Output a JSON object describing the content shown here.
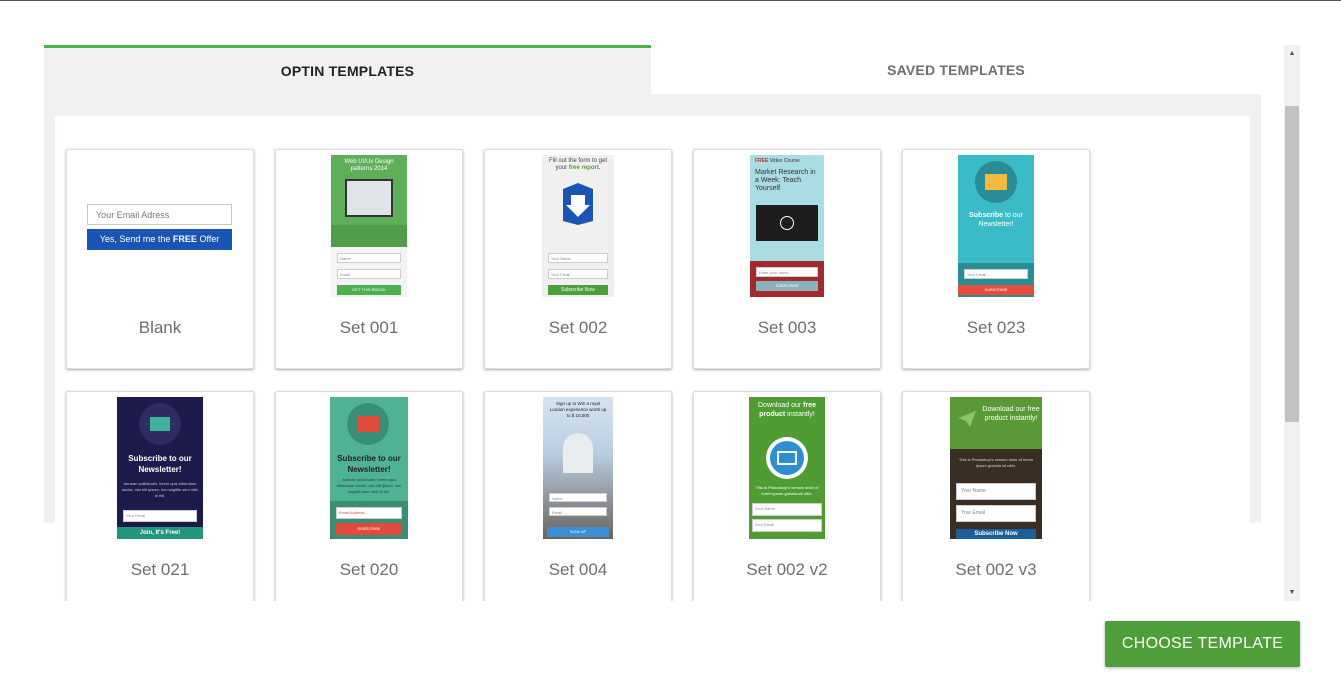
{
  "tabs": {
    "optin": "OPTIN TEMPLATES",
    "saved": "SAVED TEMPLATES"
  },
  "templates": [
    {
      "label": "Blank",
      "input_placeholder": "Your Email Adress",
      "button_pre": "Yes, Send me the ",
      "button_bold": "FREE",
      "button_post": " Offer"
    },
    {
      "label": "Set 001",
      "heading": "Web UI/Ux Design patterns 2014",
      "field1": "Name",
      "field2": "Email",
      "button": "GET THIS EBOOK"
    },
    {
      "label": "Set 002",
      "heading_pre": "Fill out the form to get your ",
      "heading_bold": "free report.",
      "field1": "Your Name",
      "field2": "Your Email",
      "button": "Subscribe Now"
    },
    {
      "label": "Set 003",
      "tag": "FREE",
      "tag_rest": " Video Course",
      "heading": "Market Research in a Week: Teach Yourself",
      "field1": "Enter your name",
      "button": "SUBSCRIBE"
    },
    {
      "label": "Set 023",
      "heading_bold": "Subscribe",
      "heading_rest": " to our Newsletter!",
      "field1": "Your Email",
      "button": "SUBSCRIBE"
    },
    {
      "label": "Set 021",
      "heading": "Subscribe to our Newsletter!",
      "body": "Aenean sollicitudin, lorem quis bibendum auctor, nisi elit ipsum, nec sagittis sem nibh id elit.",
      "field1": "Your Email",
      "button": "Join, It's Free!"
    },
    {
      "label": "Set 020",
      "heading": "Subscribe to our Newsletter!",
      "body": "Aenean sollicitudin, lorem quis bibendum auctor, nisi elit ipsum, nec sagittis sem nibh id elit.",
      "field1": "Email Address...",
      "button": "SUBSCRIBE"
    },
    {
      "label": "Set 004",
      "heading": "Sign up to Win a royal London experience worth up to $ 10,000",
      "field1": "Name",
      "field2": "Email",
      "button": "SIGN UP"
    },
    {
      "label": "Set 002 v2",
      "heading_pre": "Download our ",
      "heading_bold": "free product",
      "heading_post": " instantly!",
      "body": "This is Photoshop's version dolor of lorem ipsum gravida sit nibh.",
      "field1": "Your Name",
      "field2": "Your Email"
    },
    {
      "label": "Set 002 v3",
      "heading": "Download our free product instantly!",
      "body": "This is Photoshop's version dolor of lorem ipsum gravida sit nibh.",
      "field1": "Your Name",
      "field2": "Your Email",
      "button": "Subscribe Now"
    }
  ],
  "footer": {
    "choose_label": "CHOOSE TEMPLATE"
  },
  "colors": {
    "accent_green": "#4caf50",
    "button_green": "#4e9e3a",
    "blank_button_blue": "#1a55b5"
  }
}
